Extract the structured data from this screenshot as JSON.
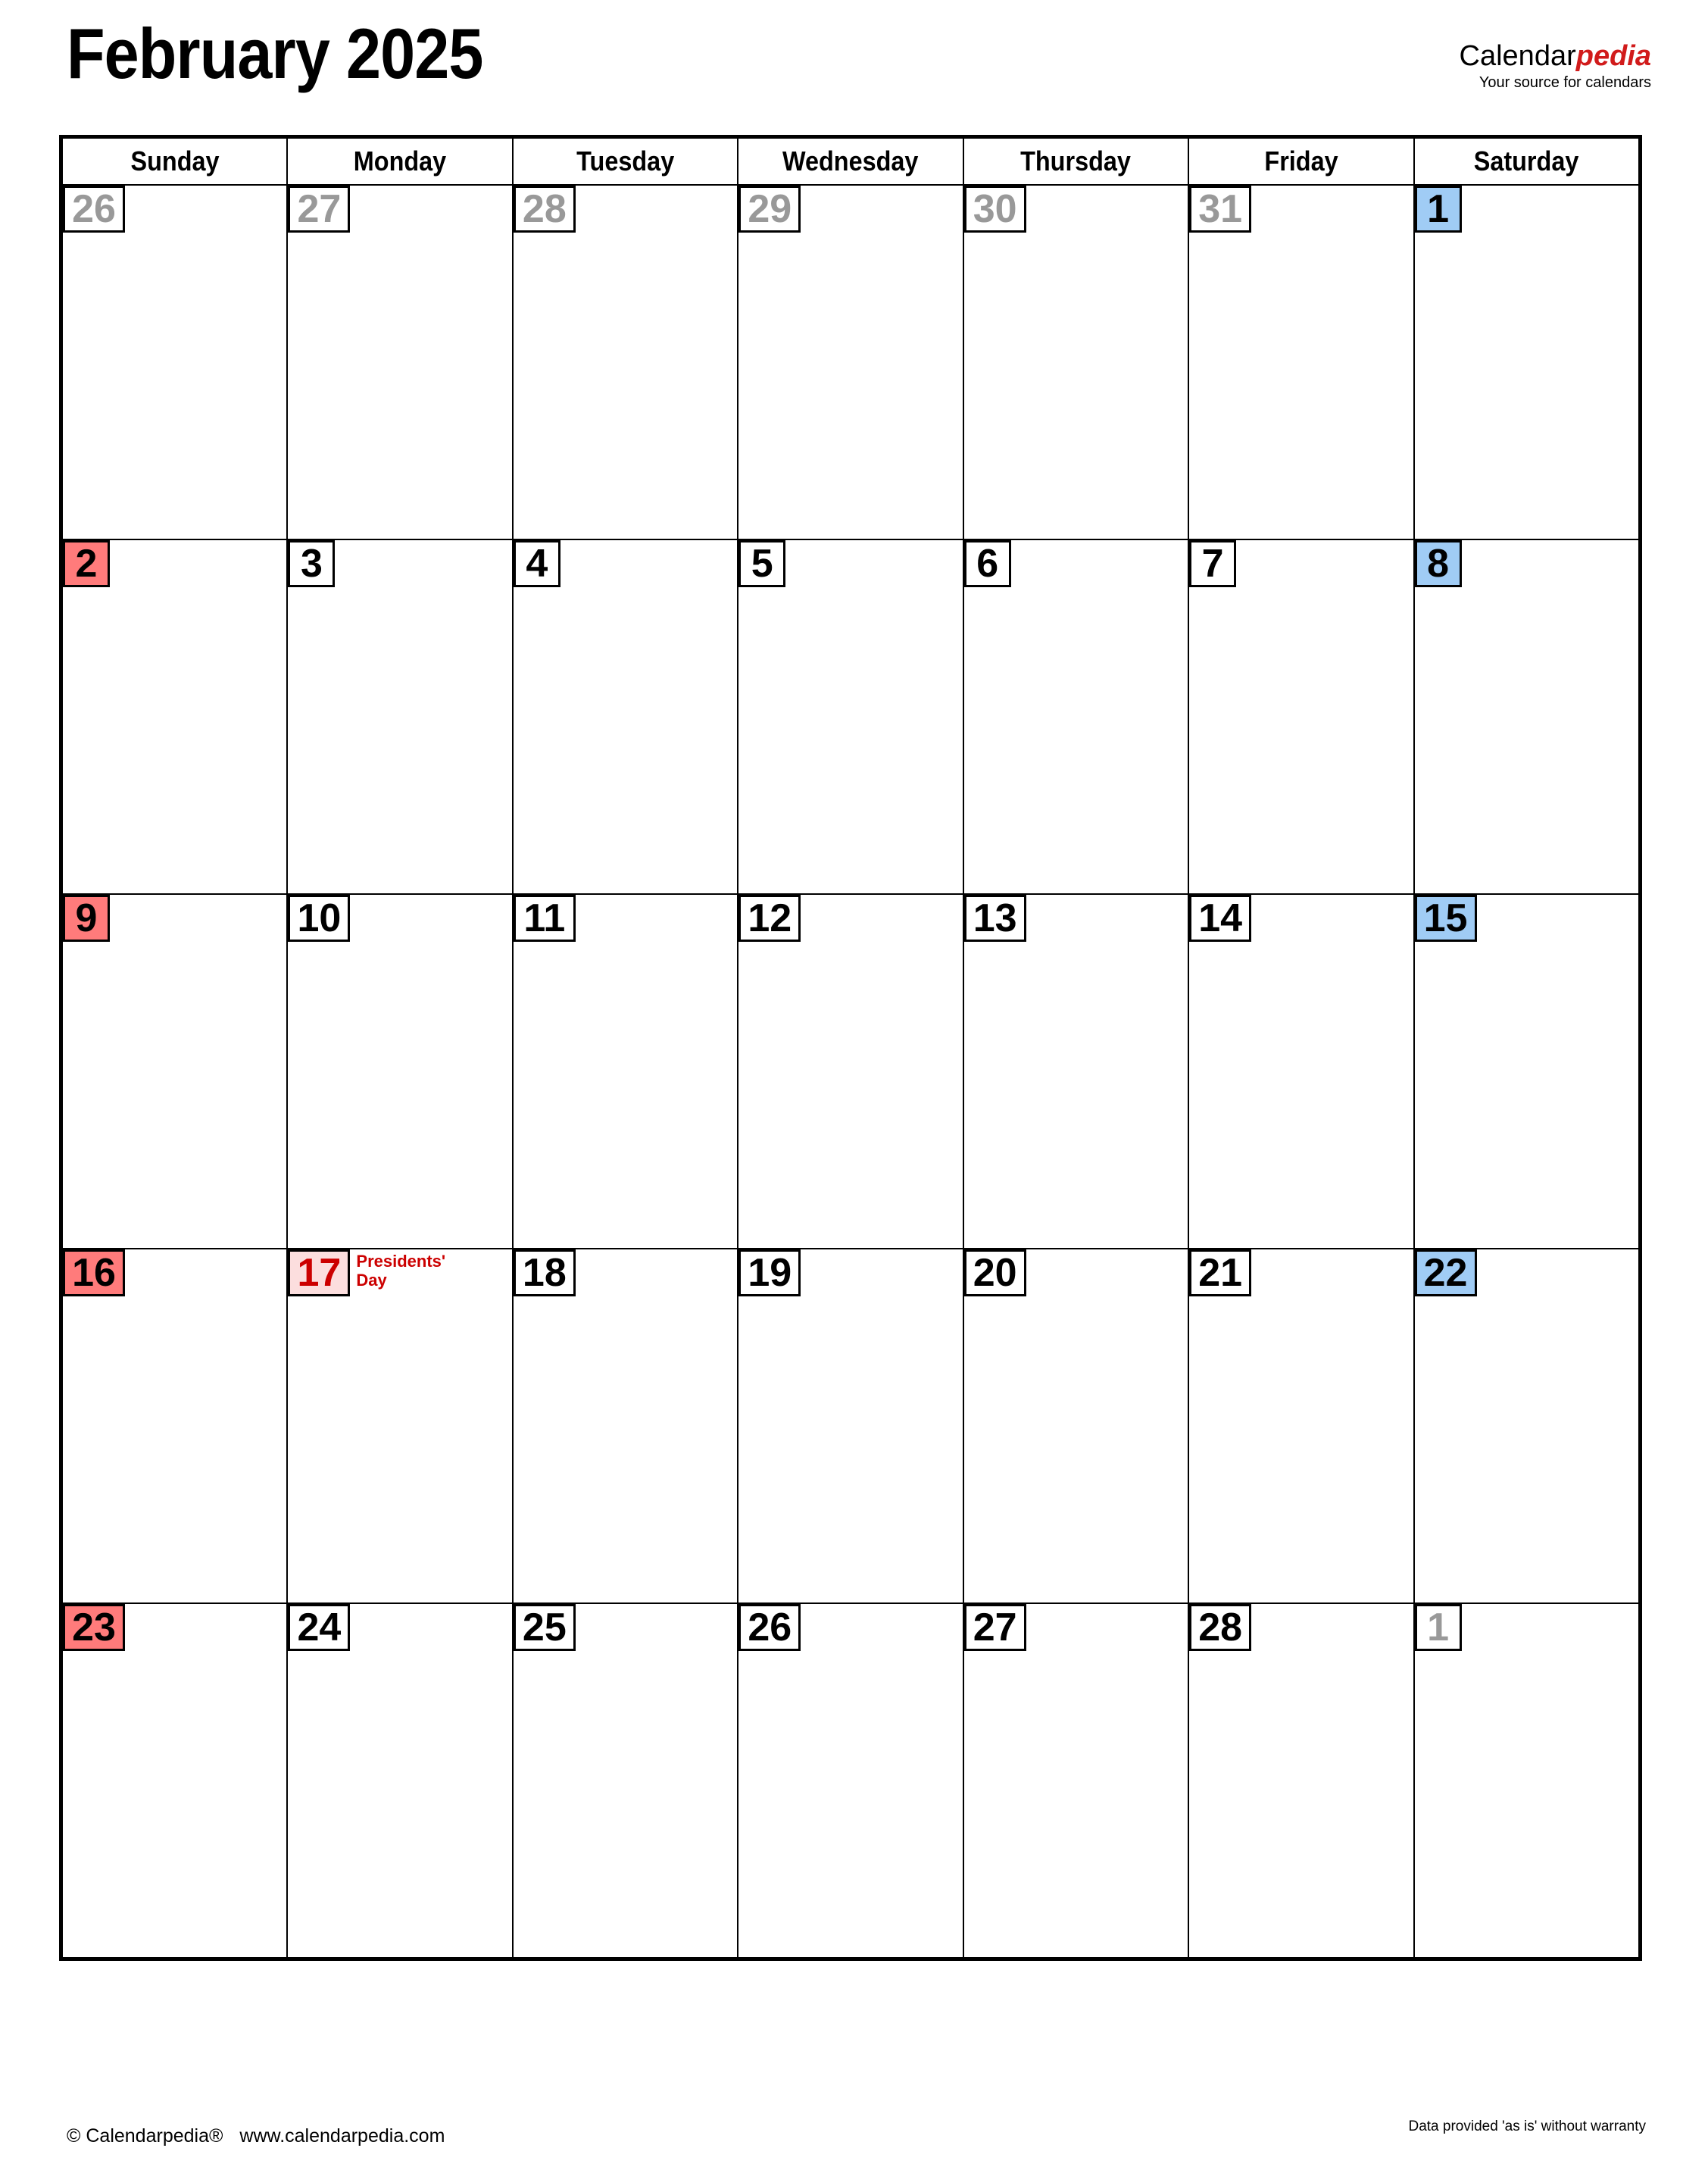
{
  "header": {
    "month_title": "February 2025",
    "brand_primary": "Calendar",
    "brand_accent": "pedia",
    "brand_tagline": "Your source for calendars"
  },
  "colors": {
    "sunday_bg": "#ff7b7b",
    "saturday_bg": "#a0ccf5",
    "holiday_bg": "#fcdede",
    "holiday_text": "#cc0000",
    "other_month_text": "#999999",
    "accent_red": "#d11b1b",
    "border": "#000000"
  },
  "weekdays": [
    {
      "label": "Sunday",
      "type": "sunday"
    },
    {
      "label": "Monday",
      "type": "weekday"
    },
    {
      "label": "Tuesday",
      "type": "weekday"
    },
    {
      "label": "Wednesday",
      "type": "weekday"
    },
    {
      "label": "Thursday",
      "type": "weekday"
    },
    {
      "label": "Friday",
      "type": "weekday"
    },
    {
      "label": "Saturday",
      "type": "saturday"
    }
  ],
  "weeks": [
    [
      {
        "day": "26",
        "month": "other",
        "col": "sunday",
        "event": ""
      },
      {
        "day": "27",
        "month": "other",
        "col": "weekday",
        "event": ""
      },
      {
        "day": "28",
        "month": "other",
        "col": "weekday",
        "event": ""
      },
      {
        "day": "29",
        "month": "other",
        "col": "weekday",
        "event": ""
      },
      {
        "day": "30",
        "month": "other",
        "col": "weekday",
        "event": ""
      },
      {
        "day": "31",
        "month": "other",
        "col": "weekday",
        "event": ""
      },
      {
        "day": "1",
        "month": "current",
        "col": "saturday",
        "event": ""
      }
    ],
    [
      {
        "day": "2",
        "month": "current",
        "col": "sunday",
        "event": ""
      },
      {
        "day": "3",
        "month": "current",
        "col": "weekday",
        "event": ""
      },
      {
        "day": "4",
        "month": "current",
        "col": "weekday",
        "event": ""
      },
      {
        "day": "5",
        "month": "current",
        "col": "weekday",
        "event": ""
      },
      {
        "day": "6",
        "month": "current",
        "col": "weekday",
        "event": ""
      },
      {
        "day": "7",
        "month": "current",
        "col": "weekday",
        "event": ""
      },
      {
        "day": "8",
        "month": "current",
        "col": "saturday",
        "event": ""
      }
    ],
    [
      {
        "day": "9",
        "month": "current",
        "col": "sunday",
        "event": ""
      },
      {
        "day": "10",
        "month": "current",
        "col": "weekday",
        "event": ""
      },
      {
        "day": "11",
        "month": "current",
        "col": "weekday",
        "event": ""
      },
      {
        "day": "12",
        "month": "current",
        "col": "weekday",
        "event": ""
      },
      {
        "day": "13",
        "month": "current",
        "col": "weekday",
        "event": ""
      },
      {
        "day": "14",
        "month": "current",
        "col": "weekday",
        "event": ""
      },
      {
        "day": "15",
        "month": "current",
        "col": "saturday",
        "event": ""
      }
    ],
    [
      {
        "day": "16",
        "month": "current",
        "col": "sunday",
        "event": ""
      },
      {
        "day": "17",
        "month": "current",
        "col": "weekday",
        "event": "Presidents' Day",
        "holiday": true
      },
      {
        "day": "18",
        "month": "current",
        "col": "weekday",
        "event": ""
      },
      {
        "day": "19",
        "month": "current",
        "col": "weekday",
        "event": ""
      },
      {
        "day": "20",
        "month": "current",
        "col": "weekday",
        "event": ""
      },
      {
        "day": "21",
        "month": "current",
        "col": "weekday",
        "event": ""
      },
      {
        "day": "22",
        "month": "current",
        "col": "saturday",
        "event": ""
      }
    ],
    [
      {
        "day": "23",
        "month": "current",
        "col": "sunday",
        "event": ""
      },
      {
        "day": "24",
        "month": "current",
        "col": "weekday",
        "event": ""
      },
      {
        "day": "25",
        "month": "current",
        "col": "weekday",
        "event": ""
      },
      {
        "day": "26",
        "month": "current",
        "col": "weekday",
        "event": ""
      },
      {
        "day": "27",
        "month": "current",
        "col": "weekday",
        "event": ""
      },
      {
        "day": "28",
        "month": "current",
        "col": "weekday",
        "event": ""
      },
      {
        "day": "1",
        "month": "other",
        "col": "saturday",
        "event": ""
      }
    ]
  ],
  "footer": {
    "copyright": "© Calendarpedia®",
    "website": "www.calendarpedia.com",
    "disclaimer": "Data provided 'as is' without warranty"
  }
}
